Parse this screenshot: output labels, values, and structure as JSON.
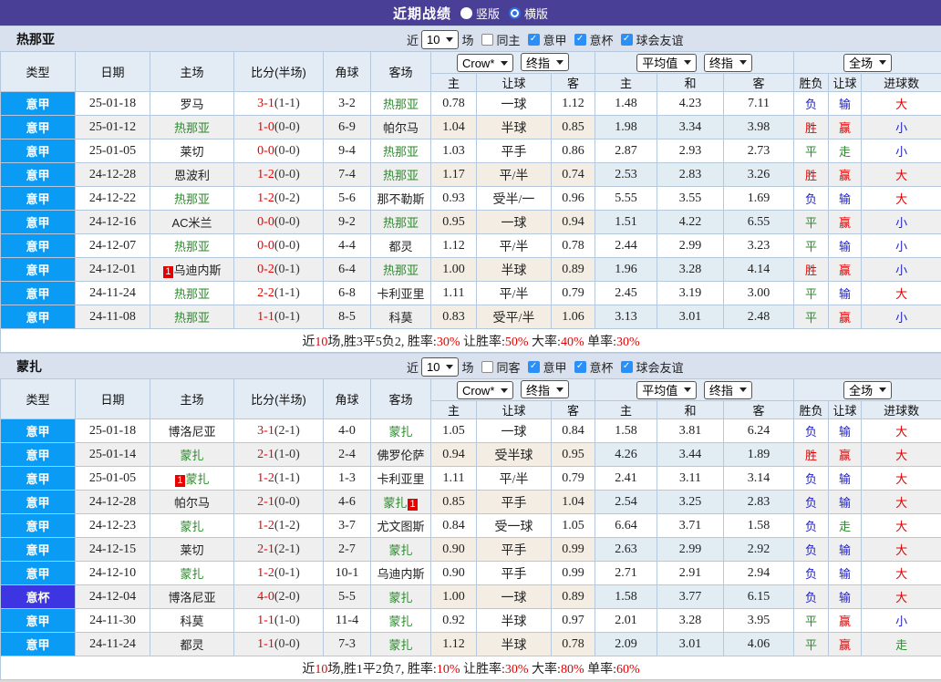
{
  "topbar": {
    "title": "近期战绩",
    "vertical_label": "竖版",
    "horizontal_label": "横版",
    "selected_option": "横版"
  },
  "icons": {
    "checkmark": "✓"
  },
  "controls": {
    "recent_label": "近",
    "recent_value": "10",
    "matches_label": "场",
    "league_label": "意甲",
    "cup_label": "意杯",
    "friendly_label": "球会友谊"
  },
  "table_header": {
    "col_type": "类型",
    "col_date": "日期",
    "col_home": "主场",
    "col_score": "比分(半场)",
    "col_corner": "角球",
    "col_away": "客场",
    "dd_crow": "Crow*",
    "dd_final": "终指",
    "dd_average": "平均值",
    "dd_final2": "终指",
    "dd_fulltime": "全场",
    "sub_home": "主",
    "sub_handicap": "让球",
    "sub_away": "客",
    "sub_h": "主",
    "sub_draw": "和",
    "sub_a": "客",
    "col_result": "胜负",
    "col_handicap_result": "让球",
    "col_goals": "进球数"
  },
  "colors": {
    "topbar_bg": "#4a3f96",
    "league_badge": "#0a9cf5",
    "cup_badge": "#3d35e2",
    "focus_team": "#2d8a2d",
    "red": "#e60000",
    "outcome": {
      "胜": "#e60000",
      "赢": "#e60000",
      "大": "#e60000",
      "平": "#2d8a2d",
      "走": "#2d8a2d",
      "负": "#2222cc",
      "输": "#2222cc",
      "小": "#2222cc"
    }
  },
  "sections": [
    {
      "team": "热那亚",
      "same_label": "同主",
      "summary": [
        {
          "t": "近",
          "c": 0
        },
        {
          "t": "10",
          "c": 1
        },
        {
          "t": "场,胜3平5负2, 胜率:",
          "c": 0
        },
        {
          "t": "30%",
          "c": 1
        },
        {
          "t": " 让胜率:",
          "c": 0
        },
        {
          "t": "50%",
          "c": 1
        },
        {
          "t": " 大率:",
          "c": 0
        },
        {
          "t": "40%",
          "c": 1
        },
        {
          "t": " 单率:",
          "c": 0
        },
        {
          "t": "30%",
          "c": 1
        }
      ],
      "rows": [
        {
          "type": "意甲",
          "type_style": "league",
          "date": "25-01-18",
          "home": "罗马",
          "home_focus": false,
          "score": "3-1",
          "half": "(1-1)",
          "corner": "3-2",
          "away": "热那亚",
          "away_focus": true,
          "crow": [
            "0.78",
            "一球",
            "1.12"
          ],
          "avg": [
            "1.48",
            "4.23",
            "7.11"
          ],
          "outcome": [
            "负",
            "输",
            "大"
          ]
        },
        {
          "type": "意甲",
          "type_style": "league",
          "date": "25-01-12",
          "home": "热那亚",
          "home_focus": true,
          "score": "1-0",
          "half": "(0-0)",
          "corner": "6-9",
          "away": "帕尔马",
          "away_focus": false,
          "crow": [
            "1.04",
            "半球",
            "0.85"
          ],
          "avg": [
            "1.98",
            "3.34",
            "3.98"
          ],
          "outcome": [
            "胜",
            "赢",
            "小"
          ]
        },
        {
          "type": "意甲",
          "type_style": "league",
          "date": "25-01-05",
          "home": "莱切",
          "home_focus": false,
          "score": "0-0",
          "half": "(0-0)",
          "corner": "9-4",
          "away": "热那亚",
          "away_focus": true,
          "crow": [
            "1.03",
            "平手",
            "0.86"
          ],
          "avg": [
            "2.87",
            "2.93",
            "2.73"
          ],
          "outcome": [
            "平",
            "走",
            "小"
          ]
        },
        {
          "type": "意甲",
          "type_style": "league",
          "date": "24-12-28",
          "home": "恩波利",
          "home_focus": false,
          "score": "1-2",
          "half": "(0-0)",
          "corner": "7-4",
          "away": "热那亚",
          "away_focus": true,
          "crow": [
            "1.17",
            "平/半",
            "0.74"
          ],
          "avg": [
            "2.53",
            "2.83",
            "3.26"
          ],
          "outcome": [
            "胜",
            "赢",
            "大"
          ]
        },
        {
          "type": "意甲",
          "type_style": "league",
          "date": "24-12-22",
          "home": "热那亚",
          "home_focus": true,
          "score": "1-2",
          "half": "(0-2)",
          "corner": "5-6",
          "away": "那不勒斯",
          "away_focus": false,
          "crow": [
            "0.93",
            "受半/一",
            "0.96"
          ],
          "avg": [
            "5.55",
            "3.55",
            "1.69"
          ],
          "outcome": [
            "负",
            "输",
            "大"
          ]
        },
        {
          "type": "意甲",
          "type_style": "league",
          "date": "24-12-16",
          "home": "AC米兰",
          "home_focus": false,
          "score": "0-0",
          "half": "(0-0)",
          "corner": "9-2",
          "away": "热那亚",
          "away_focus": true,
          "crow": [
            "0.95",
            "一球",
            "0.94"
          ],
          "avg": [
            "1.51",
            "4.22",
            "6.55"
          ],
          "outcome": [
            "平",
            "赢",
            "小"
          ]
        },
        {
          "type": "意甲",
          "type_style": "league",
          "date": "24-12-07",
          "home": "热那亚",
          "home_focus": true,
          "score": "0-0",
          "half": "(0-0)",
          "corner": "4-4",
          "away": "都灵",
          "away_focus": false,
          "crow": [
            "1.12",
            "平/半",
            "0.78"
          ],
          "avg": [
            "2.44",
            "2.99",
            "3.23"
          ],
          "outcome": [
            "平",
            "输",
            "小"
          ]
        },
        {
          "type": "意甲",
          "type_style": "league",
          "date": "24-12-01",
          "home": "乌迪内斯",
          "home_focus": false,
          "home_badge": "1",
          "home_badge_pos": "before",
          "score": "0-2",
          "half": "(0-1)",
          "corner": "6-4",
          "away": "热那亚",
          "away_focus": true,
          "crow": [
            "1.00",
            "半球",
            "0.89"
          ],
          "avg": [
            "1.96",
            "3.28",
            "4.14"
          ],
          "outcome": [
            "胜",
            "赢",
            "小"
          ]
        },
        {
          "type": "意甲",
          "type_style": "league",
          "date": "24-11-24",
          "home": "热那亚",
          "home_focus": true,
          "score": "2-2",
          "half": "(1-1)",
          "corner": "6-8",
          "away": "卡利亚里",
          "away_focus": false,
          "crow": [
            "1.11",
            "平/半",
            "0.79"
          ],
          "avg": [
            "2.45",
            "3.19",
            "3.00"
          ],
          "outcome": [
            "平",
            "输",
            "大"
          ]
        },
        {
          "type": "意甲",
          "type_style": "league",
          "date": "24-11-08",
          "home": "热那亚",
          "home_focus": true,
          "score": "1-1",
          "half": "(0-1)",
          "corner": "8-5",
          "away": "科莫",
          "away_focus": false,
          "crow": [
            "0.83",
            "受平/半",
            "1.06"
          ],
          "avg": [
            "3.13",
            "3.01",
            "2.48"
          ],
          "outcome": [
            "平",
            "赢",
            "小"
          ]
        }
      ]
    },
    {
      "team": "蒙扎",
      "same_label": "同客",
      "summary": [
        {
          "t": "近",
          "c": 0
        },
        {
          "t": "10",
          "c": 1
        },
        {
          "t": "场,胜1平2负7, 胜率:",
          "c": 0
        },
        {
          "t": "10%",
          "c": 1
        },
        {
          "t": " 让胜率:",
          "c": 0
        },
        {
          "t": "30%",
          "c": 1
        },
        {
          "t": " 大率:",
          "c": 0
        },
        {
          "t": "80%",
          "c": 1
        },
        {
          "t": " 单率:",
          "c": 0
        },
        {
          "t": "60%",
          "c": 1
        }
      ],
      "rows": [
        {
          "type": "意甲",
          "type_style": "league",
          "date": "25-01-18",
          "home": "博洛尼亚",
          "home_focus": false,
          "score": "3-1",
          "half": "(2-1)",
          "corner": "4-0",
          "away": "蒙扎",
          "away_focus": true,
          "crow": [
            "1.05",
            "一球",
            "0.84"
          ],
          "avg": [
            "1.58",
            "3.81",
            "6.24"
          ],
          "outcome": [
            "负",
            "输",
            "大"
          ]
        },
        {
          "type": "意甲",
          "type_style": "league",
          "date": "25-01-14",
          "home": "蒙扎",
          "home_focus": true,
          "score": "2-1",
          "half": "(1-0)",
          "corner": "2-4",
          "away": "佛罗伦萨",
          "away_focus": false,
          "crow": [
            "0.94",
            "受半球",
            "0.95"
          ],
          "avg": [
            "4.26",
            "3.44",
            "1.89"
          ],
          "outcome": [
            "胜",
            "赢",
            "大"
          ]
        },
        {
          "type": "意甲",
          "type_style": "league",
          "date": "25-01-05",
          "home": "蒙扎",
          "home_focus": true,
          "home_badge": "1",
          "home_badge_pos": "before",
          "score": "1-2",
          "half": "(1-1)",
          "corner": "1-3",
          "away": "卡利亚里",
          "away_focus": false,
          "crow": [
            "1.11",
            "平/半",
            "0.79"
          ],
          "avg": [
            "2.41",
            "3.11",
            "3.14"
          ],
          "outcome": [
            "负",
            "输",
            "大"
          ]
        },
        {
          "type": "意甲",
          "type_style": "league",
          "date": "24-12-28",
          "home": "帕尔马",
          "home_focus": false,
          "score": "2-1",
          "half": "(0-0)",
          "corner": "4-6",
          "away": "蒙扎",
          "away_focus": true,
          "away_badge": "1",
          "away_badge_pos": "after",
          "crow": [
            "0.85",
            "平手",
            "1.04"
          ],
          "avg": [
            "2.54",
            "3.25",
            "2.83"
          ],
          "outcome": [
            "负",
            "输",
            "大"
          ]
        },
        {
          "type": "意甲",
          "type_style": "league",
          "date": "24-12-23",
          "home": "蒙扎",
          "home_focus": true,
          "score": "1-2",
          "half": "(1-2)",
          "corner": "3-7",
          "away": "尤文图斯",
          "away_focus": false,
          "crow": [
            "0.84",
            "受一球",
            "1.05"
          ],
          "avg": [
            "6.64",
            "3.71",
            "1.58"
          ],
          "outcome": [
            "负",
            "走",
            "大"
          ]
        },
        {
          "type": "意甲",
          "type_style": "league",
          "date": "24-12-15",
          "home": "莱切",
          "home_focus": false,
          "score": "2-1",
          "half": "(2-1)",
          "corner": "2-7",
          "away": "蒙扎",
          "away_focus": true,
          "crow": [
            "0.90",
            "平手",
            "0.99"
          ],
          "avg": [
            "2.63",
            "2.99",
            "2.92"
          ],
          "outcome": [
            "负",
            "输",
            "大"
          ]
        },
        {
          "type": "意甲",
          "type_style": "league",
          "date": "24-12-10",
          "home": "蒙扎",
          "home_focus": true,
          "score": "1-2",
          "half": "(0-1)",
          "corner": "10-1",
          "away": "乌迪内斯",
          "away_focus": false,
          "crow": [
            "0.90",
            "平手",
            "0.99"
          ],
          "avg": [
            "2.71",
            "2.91",
            "2.94"
          ],
          "outcome": [
            "负",
            "输",
            "大"
          ]
        },
        {
          "type": "意杯",
          "type_style": "cup",
          "date": "24-12-04",
          "home": "博洛尼亚",
          "home_focus": false,
          "score": "4-0",
          "half": "(2-0)",
          "corner": "5-5",
          "away": "蒙扎",
          "away_focus": true,
          "crow": [
            "1.00",
            "一球",
            "0.89"
          ],
          "avg": [
            "1.58",
            "3.77",
            "6.15"
          ],
          "outcome": [
            "负",
            "输",
            "大"
          ]
        },
        {
          "type": "意甲",
          "type_style": "league",
          "date": "24-11-30",
          "home": "科莫",
          "home_focus": false,
          "score": "1-1",
          "half": "(1-0)",
          "corner": "11-4",
          "away": "蒙扎",
          "away_focus": true,
          "crow": [
            "0.92",
            "半球",
            "0.97"
          ],
          "avg": [
            "2.01",
            "3.28",
            "3.95"
          ],
          "outcome": [
            "平",
            "赢",
            "小"
          ]
        },
        {
          "type": "意甲",
          "type_style": "league",
          "date": "24-11-24",
          "home": "都灵",
          "home_focus": false,
          "score": "1-1",
          "half": "(0-0)",
          "corner": "7-3",
          "away": "蒙扎",
          "away_focus": true,
          "crow": [
            "1.12",
            "半球",
            "0.78"
          ],
          "avg": [
            "2.09",
            "3.01",
            "4.06"
          ],
          "outcome": [
            "平",
            "赢",
            "走"
          ]
        }
      ]
    }
  ]
}
